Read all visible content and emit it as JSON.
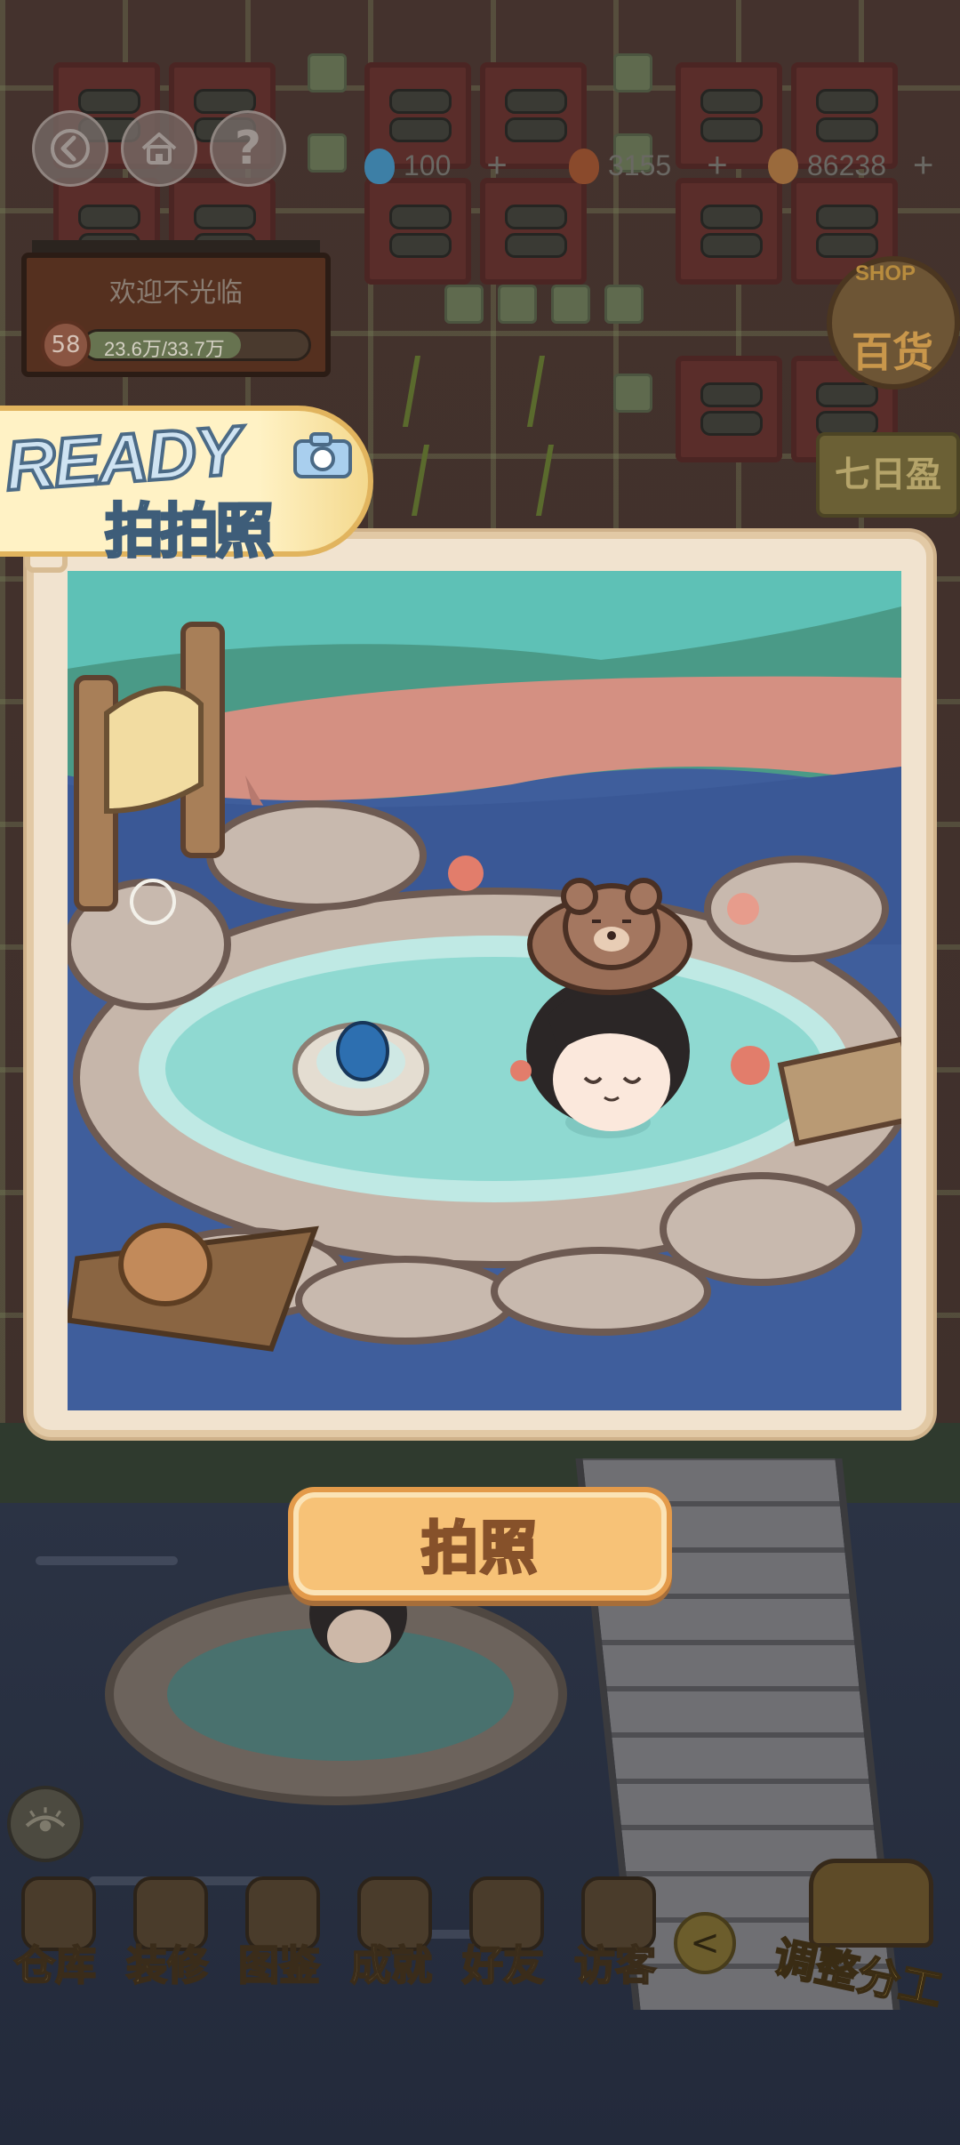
{
  "hud": {
    "back_icon": "back-arrow-icon",
    "home_icon": "home-icon",
    "help_label": "?",
    "resources": [
      {
        "name": "gem",
        "icon": "blue-drop-icon",
        "value": "100",
        "plus": "+",
        "color": "#3d7fa6"
      },
      {
        "name": "fire",
        "icon": "flame-icon",
        "value": "3155",
        "plus": "+",
        "color": "#8a4a2c"
      },
      {
        "name": "coin",
        "icon": "coin-icon",
        "value": "86238",
        "plus": "+",
        "color": "#9a6a3c"
      }
    ]
  },
  "welcome_sign": {
    "title": "欢迎不光临",
    "level": "58",
    "progress_text": "23.6万/33.7万",
    "progress_fraction": 0.7
  },
  "shop": {
    "tag": "SHOP",
    "label": "百货"
  },
  "seven_day": {
    "label": "七日盈实"
  },
  "ready_banner": {
    "title": "READY",
    "subtitle": "拍拍照",
    "icon": "camera-icon"
  },
  "photo": {
    "description_icon": "hot-spring-scene"
  },
  "shoot_button": {
    "label": "拍照"
  },
  "toolbar": {
    "items": [
      {
        "label": "仓库",
        "icon": "warehouse-icon"
      },
      {
        "label": "装修",
        "icon": "hammer-icon"
      },
      {
        "label": "图鉴",
        "icon": "book-icon"
      },
      {
        "label": "成就",
        "icon": "trophy-icon"
      },
      {
        "label": "好友",
        "icon": "friend-icon"
      },
      {
        "label": "访客",
        "icon": "phone-icon"
      }
    ],
    "collapse_label": "<",
    "eye_icon": "eye-icon",
    "adjust_label": "调整分工"
  },
  "colors": {
    "accent_orange": "#f7c277",
    "frame_cream": "#f1e3cf",
    "banner_gold": "#e1b45e"
  }
}
